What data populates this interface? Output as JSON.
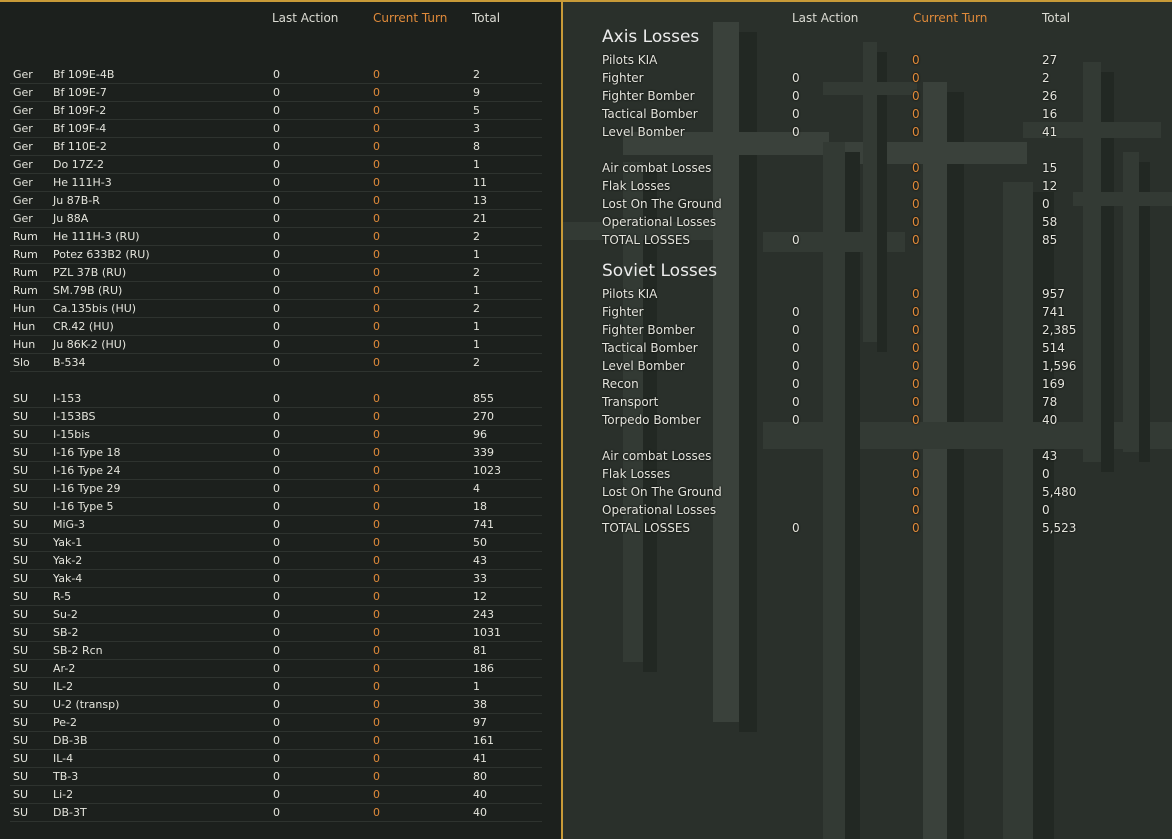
{
  "headers": {
    "last_action": "Last Action",
    "current_turn": "Current Turn",
    "total": "Total"
  },
  "colors": {
    "accent": "#c89a38",
    "current_turn": "#e08a3a",
    "text": "#e4e4dc"
  },
  "aircraft_groups": [
    [
      {
        "nation": "Ger",
        "type": "Bf 109E-4B",
        "last": "0",
        "current": "0",
        "total": "2"
      },
      {
        "nation": "Ger",
        "type": "Bf 109E-7",
        "last": "0",
        "current": "0",
        "total": "9"
      },
      {
        "nation": "Ger",
        "type": "Bf 109F-2",
        "last": "0",
        "current": "0",
        "total": "5"
      },
      {
        "nation": "Ger",
        "type": "Bf 109F-4",
        "last": "0",
        "current": "0",
        "total": "3"
      },
      {
        "nation": "Ger",
        "type": "Bf 110E-2",
        "last": "0",
        "current": "0",
        "total": "8"
      },
      {
        "nation": "Ger",
        "type": "Do 17Z-2",
        "last": "0",
        "current": "0",
        "total": "1"
      },
      {
        "nation": "Ger",
        "type": "He 111H-3",
        "last": "0",
        "current": "0",
        "total": "11"
      },
      {
        "nation": "Ger",
        "type": "Ju 87B-R",
        "last": "0",
        "current": "0",
        "total": "13"
      },
      {
        "nation": "Ger",
        "type": "Ju 88A",
        "last": "0",
        "current": "0",
        "total": "21"
      },
      {
        "nation": "Rum",
        "type": "He 111H-3 (RU)",
        "last": "0",
        "current": "0",
        "total": "2"
      },
      {
        "nation": "Rum",
        "type": "Potez 633B2 (RU)",
        "last": "0",
        "current": "0",
        "total": "1"
      },
      {
        "nation": "Rum",
        "type": "PZL 37B (RU)",
        "last": "0",
        "current": "0",
        "total": "2"
      },
      {
        "nation": "Rum",
        "type": "SM.79B (RU)",
        "last": "0",
        "current": "0",
        "total": "1"
      },
      {
        "nation": "Hun",
        "type": "Ca.135bis (HU)",
        "last": "0",
        "current": "0",
        "total": "2"
      },
      {
        "nation": "Hun",
        "type": "CR.42 (HU)",
        "last": "0",
        "current": "0",
        "total": "1"
      },
      {
        "nation": "Hun",
        "type": "Ju 86K-2 (HU)",
        "last": "0",
        "current": "0",
        "total": "1"
      },
      {
        "nation": "Slo",
        "type": "B-534",
        "last": "0",
        "current": "0",
        "total": "2"
      }
    ],
    [
      {
        "nation": "SU",
        "type": "I-153",
        "last": "0",
        "current": "0",
        "total": "855"
      },
      {
        "nation": "SU",
        "type": "I-153BS",
        "last": "0",
        "current": "0",
        "total": "270"
      },
      {
        "nation": "SU",
        "type": "I-15bis",
        "last": "0",
        "current": "0",
        "total": "96"
      },
      {
        "nation": "SU",
        "type": "I-16 Type 18",
        "last": "0",
        "current": "0",
        "total": "339"
      },
      {
        "nation": "SU",
        "type": "I-16 Type 24",
        "last": "0",
        "current": "0",
        "total": "1023"
      },
      {
        "nation": "SU",
        "type": "I-16 Type 29",
        "last": "0",
        "current": "0",
        "total": "4"
      },
      {
        "nation": "SU",
        "type": "I-16 Type 5",
        "last": "0",
        "current": "0",
        "total": "18"
      },
      {
        "nation": "SU",
        "type": "MiG-3",
        "last": "0",
        "current": "0",
        "total": "741"
      },
      {
        "nation": "SU",
        "type": "Yak-1",
        "last": "0",
        "current": "0",
        "total": "50"
      },
      {
        "nation": "SU",
        "type": "Yak-2",
        "last": "0",
        "current": "0",
        "total": "43"
      },
      {
        "nation": "SU",
        "type": "Yak-4",
        "last": "0",
        "current": "0",
        "total": "33"
      },
      {
        "nation": "SU",
        "type": "R-5",
        "last": "0",
        "current": "0",
        "total": "12"
      },
      {
        "nation": "SU",
        "type": "Su-2",
        "last": "0",
        "current": "0",
        "total": "243"
      },
      {
        "nation": "SU",
        "type": "SB-2",
        "last": "0",
        "current": "0",
        "total": "1031"
      },
      {
        "nation": "SU",
        "type": "SB-2 Rcn",
        "last": "0",
        "current": "0",
        "total": "81"
      },
      {
        "nation": "SU",
        "type": "Ar-2",
        "last": "0",
        "current": "0",
        "total": "186"
      },
      {
        "nation": "SU",
        "type": "IL-2",
        "last": "0",
        "current": "0",
        "total": "1"
      },
      {
        "nation": "SU",
        "type": "U-2 (transp)",
        "last": "0",
        "current": "0",
        "total": "38"
      },
      {
        "nation": "SU",
        "type": "Pe-2",
        "last": "0",
        "current": "0",
        "total": "97"
      },
      {
        "nation": "SU",
        "type": "DB-3B",
        "last": "0",
        "current": "0",
        "total": "161"
      },
      {
        "nation": "SU",
        "type": "IL-4",
        "last": "0",
        "current": "0",
        "total": "41"
      },
      {
        "nation": "SU",
        "type": "TB-3",
        "last": "0",
        "current": "0",
        "total": "80"
      },
      {
        "nation": "SU",
        "type": "Li-2",
        "last": "0",
        "current": "0",
        "total": "40"
      },
      {
        "nation": "SU",
        "type": "DB-3T",
        "last": "0",
        "current": "0",
        "total": "40"
      }
    ]
  ],
  "axis_losses": {
    "title": "Axis Losses",
    "groups": [
      [
        {
          "label": "Pilots KIA",
          "last": "",
          "current": "0",
          "total": "27"
        },
        {
          "label": "Fighter",
          "last": "0",
          "current": "0",
          "total": "2"
        },
        {
          "label": "Fighter Bomber",
          "last": "0",
          "current": "0",
          "total": "26"
        },
        {
          "label": "Tactical Bomber",
          "last": "0",
          "current": "0",
          "total": "16"
        },
        {
          "label": "Level Bomber",
          "last": "0",
          "current": "0",
          "total": "41"
        }
      ],
      [
        {
          "label": "Air combat Losses",
          "last": "",
          "current": "0",
          "total": "15"
        },
        {
          "label": "Flak Losses",
          "last": "",
          "current": "0",
          "total": "12"
        },
        {
          "label": "Lost On The Ground",
          "last": "",
          "current": "0",
          "total": "0"
        },
        {
          "label": "Operational Losses",
          "last": "",
          "current": "0",
          "total": "58"
        },
        {
          "label": "TOTAL LOSSES",
          "last": "0",
          "current": "0",
          "total": "85"
        }
      ]
    ]
  },
  "soviet_losses": {
    "title": "Soviet Losses",
    "groups": [
      [
        {
          "label": "Pilots KIA",
          "last": "",
          "current": "0",
          "total": "957"
        },
        {
          "label": "Fighter",
          "last": "0",
          "current": "0",
          "total": "741"
        },
        {
          "label": "Fighter Bomber",
          "last": "0",
          "current": "0",
          "total": "2,385"
        },
        {
          "label": "Tactical Bomber",
          "last": "0",
          "current": "0",
          "total": "514"
        },
        {
          "label": "Level Bomber",
          "last": "0",
          "current": "0",
          "total": "1,596"
        },
        {
          "label": "Recon",
          "last": "0",
          "current": "0",
          "total": "169"
        },
        {
          "label": "Transport",
          "last": "0",
          "current": "0",
          "total": "78"
        },
        {
          "label": "Torpedo Bomber",
          "last": "0",
          "current": "0",
          "total": "40"
        }
      ],
      [
        {
          "label": "Air combat Losses",
          "last": "",
          "current": "0",
          "total": "43"
        },
        {
          "label": "Flak Losses",
          "last": "",
          "current": "0",
          "total": "0"
        },
        {
          "label": "Lost On The Ground",
          "last": "",
          "current": "0",
          "total": "5,480"
        },
        {
          "label": "Operational Losses",
          "last": "",
          "current": "0",
          "total": "0"
        },
        {
          "label": "TOTAL LOSSES",
          "last": "0",
          "current": "0",
          "total": "5,523"
        }
      ]
    ]
  }
}
